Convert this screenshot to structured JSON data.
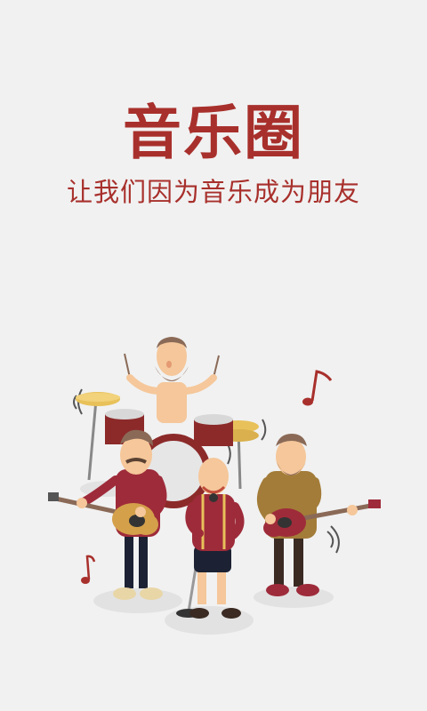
{
  "splash": {
    "app_title": "音乐圈",
    "tagline": "让我们因为音乐成为朋友"
  },
  "colors": {
    "background": "#f1f1f1",
    "accent": "#a8302c",
    "skin": "#f5c79a",
    "beard": "#8a6a57",
    "shirt_red": "#9e2b3a",
    "shirt_mustard": "#a37c39",
    "drum_red": "#8c2a2a",
    "cymbal_gold": "#e8c15a"
  },
  "illustration": {
    "name": "band-illustration",
    "members": [
      "drummer",
      "left-guitarist",
      "singer",
      "right-guitarist"
    ],
    "decorations": [
      "music-note-icon",
      "music-note-icon"
    ]
  }
}
